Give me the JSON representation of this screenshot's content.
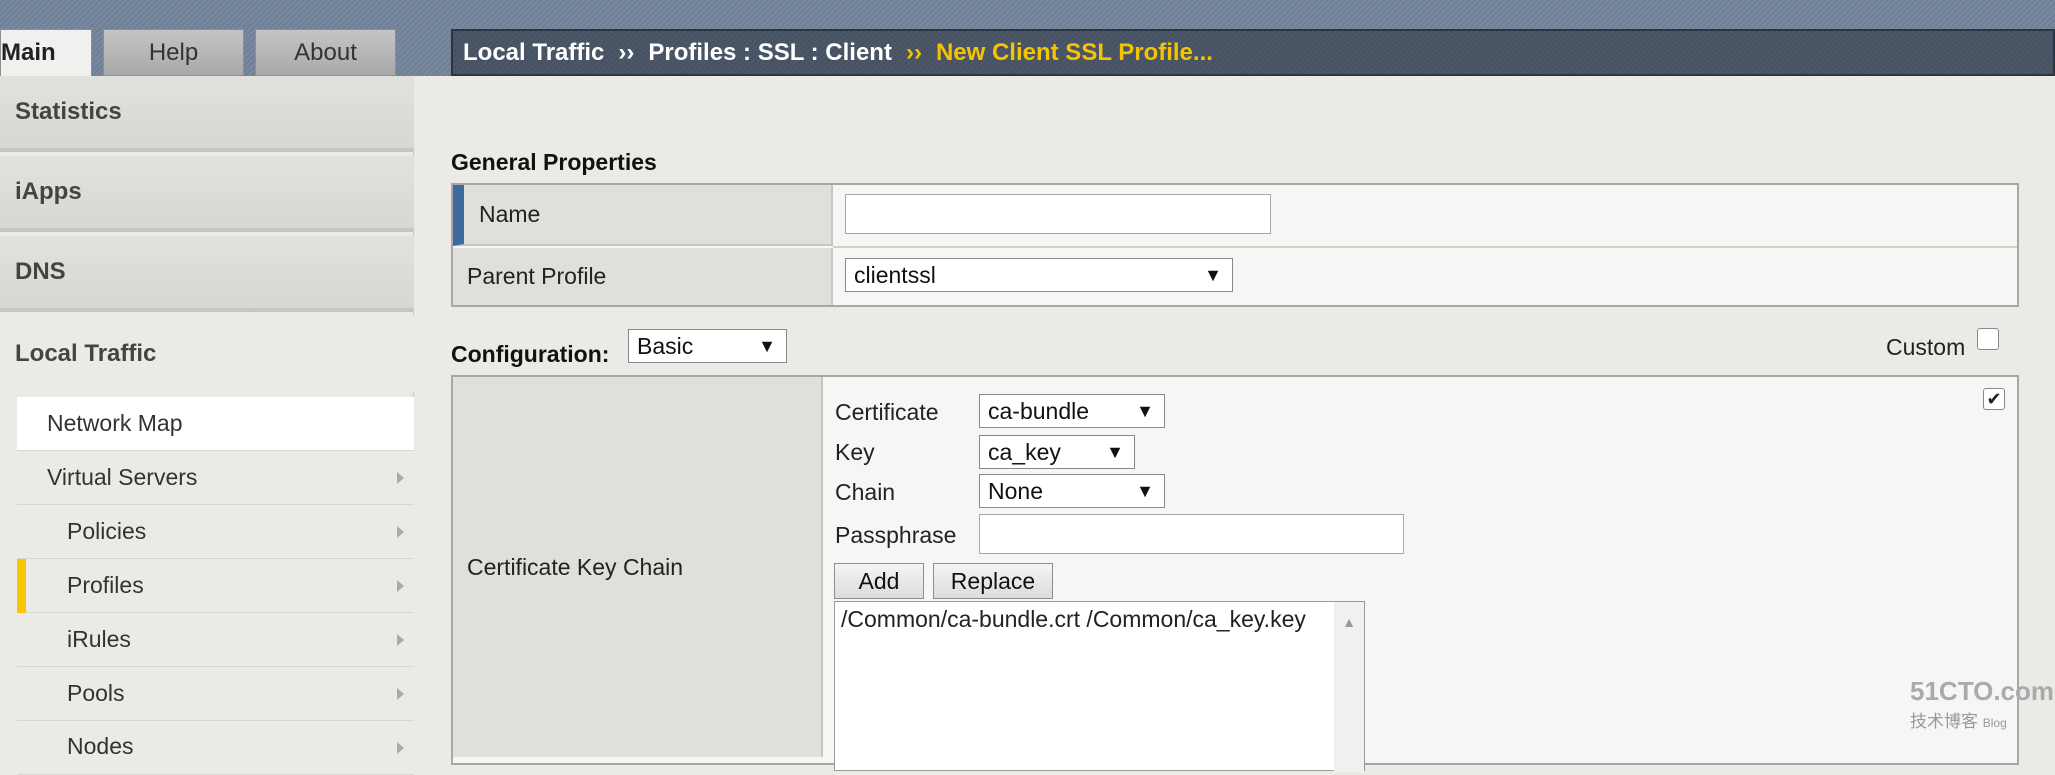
{
  "top_tabs": [
    {
      "label": "Main",
      "active": true
    },
    {
      "label": "Help"
    },
    {
      "label": "About"
    }
  ],
  "breadcrumb": {
    "parts": [
      "Local Traffic",
      "Profiles : SSL : Client"
    ],
    "separator": "››",
    "current": "New Client SSL Profile..."
  },
  "sidebar": {
    "sections": [
      {
        "label": "Statistics"
      },
      {
        "label": "iApps"
      },
      {
        "label": "DNS"
      },
      {
        "label": "Local Traffic"
      }
    ],
    "items": [
      {
        "label": "Network Map"
      },
      {
        "label": "Virtual Servers"
      },
      {
        "label": "Policies"
      },
      {
        "label": "Profiles",
        "selected": true
      },
      {
        "label": "iRules"
      },
      {
        "label": "Pools"
      },
      {
        "label": "Nodes"
      }
    ]
  },
  "general": {
    "title": "General Properties",
    "name_label": "Name",
    "name_value": "",
    "parent_label": "Parent Profile",
    "parent_value": "clientssl"
  },
  "configuration": {
    "label": "Configuration:",
    "value": "Basic",
    "custom_label": "Custom",
    "custom_checked": false
  },
  "ckc": {
    "label": "Certificate Key Chain",
    "certificate_label": "Certificate",
    "certificate_value": "ca-bundle",
    "key_label": "Key",
    "key_value": "ca_key",
    "chain_label": "Chain",
    "chain_value": "None",
    "passphrase_label": "Passphrase",
    "passphrase_value": "",
    "add_label": "Add",
    "replace_label": "Replace",
    "list_items": [
      "/Common/ca-bundle.crt /Common/ca_key.key"
    ],
    "custom_checked": true
  },
  "watermark": {
    "text": "51CTO.com",
    "sub": "技术博客",
    "blog": "Blog"
  },
  "colors": {
    "accent": "#f5c400",
    "crumb_bg": "#4c5868",
    "name_marker": "#3d6a9a"
  }
}
